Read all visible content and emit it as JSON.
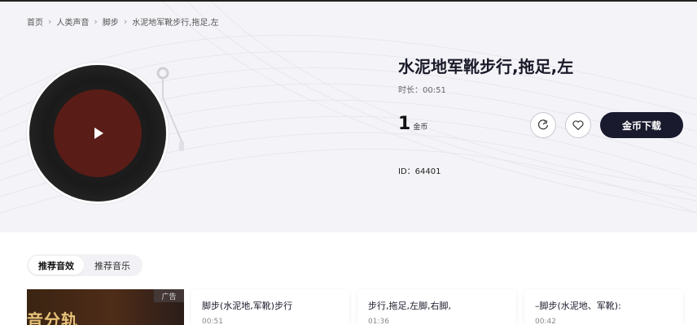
{
  "breadcrumb": {
    "items": [
      "首页",
      "人类声音",
      "脚步",
      "水泥地军靴步行,拖足,左"
    ],
    "separator": ">"
  },
  "sound": {
    "title": "水泥地军靴步行,拖足,左",
    "duration_label": "时长：00:51",
    "price_value": "1",
    "price_unit": "金币",
    "id_label": "ID：64401"
  },
  "actions": {
    "download_label": "金币下载"
  },
  "icons": {
    "play": "play-icon",
    "share": "share-icon",
    "favorite": "heart-icon",
    "breadcrumb_separator": "chevron-right-icon"
  },
  "tabs": [
    {
      "label": "推荐音效",
      "active": true
    },
    {
      "label": "推荐音乐",
      "active": false
    }
  ],
  "ad": {
    "badge": "广告",
    "text": "音分轨"
  },
  "recommended": [
    {
      "title": "脚步(水泥地,军靴)步行",
      "duration": "00:51"
    },
    {
      "title": "步行,拖足,左脚,右脚,",
      "duration": "01:36"
    },
    {
      "title": "–脚步(水泥地、军靴):",
      "duration": "00:42"
    }
  ],
  "colors": {
    "accent": "#1a1a2e",
    "vinyl_label": "#5a1c16",
    "hero_bg": "#f4f4f8"
  }
}
